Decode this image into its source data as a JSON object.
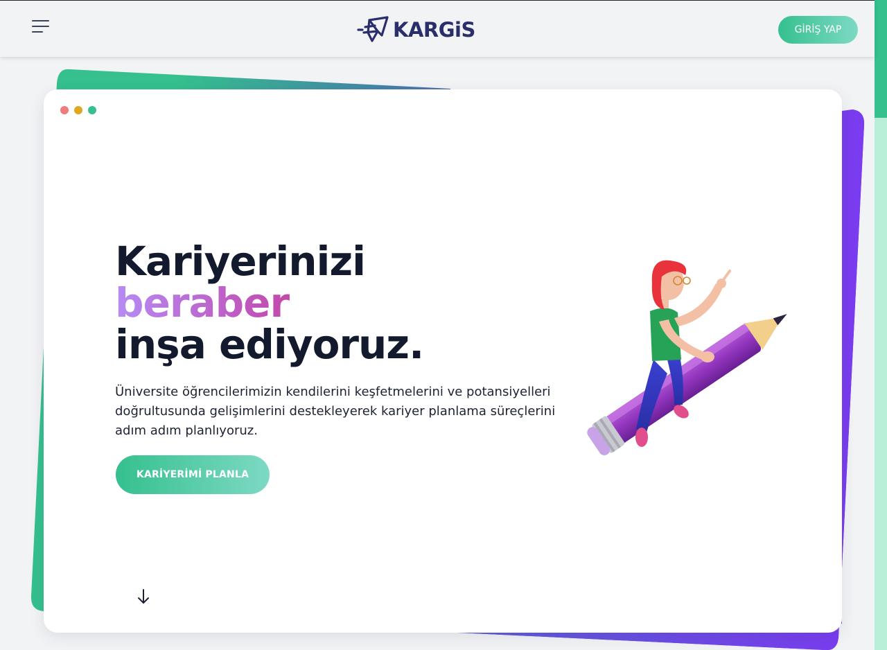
{
  "header": {
    "menu_icon": "hamburger-menu-icon",
    "logo_text": "KARGiS",
    "logo_mark": "kargis-paper-plane-logo",
    "login_label": "GİRİŞ YAP"
  },
  "hero": {
    "window_dots": [
      "#f07b7b",
      "#e0a81c",
      "#35c08e"
    ],
    "title_line1": "Kariyerinizi",
    "title_line2": "beraber",
    "title_line3": "inşa ediyoruz.",
    "description": "Üniversite öğrencilerimizin kendilerini keşfetmelerini ve potansiyelleri doğrultusunda gelişimlerini destekleyerek kariyer planlama süreçlerini adım adım planlıyoruz.",
    "cta_label": "KARİYERİMİ PLANLA",
    "scroll_icon": "arrow-down-icon",
    "illustration": "girl-riding-pencil-illustration"
  },
  "colors": {
    "brand_green": "#35c08e",
    "brand_green_light": "#7dd9c4",
    "brand_purple": "#7b3bf0",
    "brand_navy": "#2a2f6b",
    "title_accent_start": "#b58cf5",
    "title_accent_end": "#d9296f"
  }
}
